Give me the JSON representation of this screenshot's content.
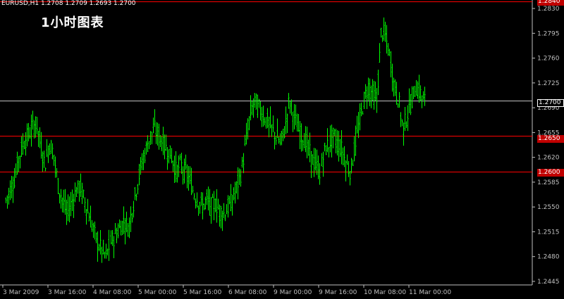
{
  "window": {
    "header": "EURUSD,H1  1.2708 1.2709 1.2693 1.2700",
    "chart_label": "1小时图表"
  },
  "colors": {
    "background": "#000000",
    "candles": "#00ff00",
    "level_lines": "#ff0000",
    "current_line": "#c0c0c0",
    "axis": "#c0c0c0"
  },
  "price_tags": {
    "top": "1.2840",
    "current": "1.2700",
    "level_1": "1.2650",
    "level_2": "1.2600"
  },
  "chart_data": {
    "type": "line",
    "symbol": "EURUSD",
    "timeframe": "H1",
    "title": "1小时图表",
    "ylim": [
      1.244,
      1.284
    ],
    "y_ticks": [
      "1.2830",
      "1.2795",
      "1.2760",
      "1.2725",
      "1.2690",
      "1.2655",
      "1.2620",
      "1.2585",
      "1.2550",
      "1.2515",
      "1.2480",
      "1.2445"
    ],
    "x_ticks": [
      "3 Mar 2009",
      "3 Mar 16:00",
      "4 Mar 08:00",
      "5 Mar 00:00",
      "5 Mar 16:00",
      "6 Mar 08:00",
      "9 Mar 00:00",
      "9 Mar 16:00",
      "10 Mar 08:00",
      "11 Mar 00:00"
    ],
    "horizontal_lines": [
      1.284,
      1.27,
      1.265,
      1.26
    ],
    "series": [
      {
        "values": [
          1.256,
          1.2575,
          1.259,
          1.262,
          1.264,
          1.265,
          1.266,
          1.267,
          1.2635,
          1.261,
          1.264,
          1.2625,
          1.258,
          1.256,
          1.254,
          1.2555,
          1.257,
          1.258,
          1.256,
          1.254,
          1.252,
          1.25,
          1.249,
          1.248,
          1.25,
          1.251,
          1.252,
          1.253,
          1.252,
          1.255,
          1.258,
          1.261,
          1.263,
          1.265,
          1.266,
          1.265,
          1.264,
          1.263,
          1.262,
          1.26,
          1.261,
          1.26,
          1.259,
          1.257,
          1.256,
          1.255,
          1.256,
          1.255,
          1.2555,
          1.2545,
          1.254,
          1.255,
          1.256,
          1.258,
          1.26,
          1.264,
          1.268,
          1.27,
          1.269,
          1.268,
          1.267,
          1.266,
          1.265,
          1.264,
          1.266,
          1.27,
          1.268,
          1.266,
          1.265,
          1.264,
          1.262,
          1.261,
          1.26,
          1.263,
          1.264,
          1.265,
          1.264,
          1.263,
          1.261,
          1.26,
          1.264,
          1.267,
          1.27,
          1.272,
          1.271,
          1.27,
          1.28,
          1.279,
          1.276,
          1.272,
          1.27,
          1.266,
          1.268,
          1.27,
          1.272,
          1.271,
          1.27
        ]
      }
    ]
  }
}
